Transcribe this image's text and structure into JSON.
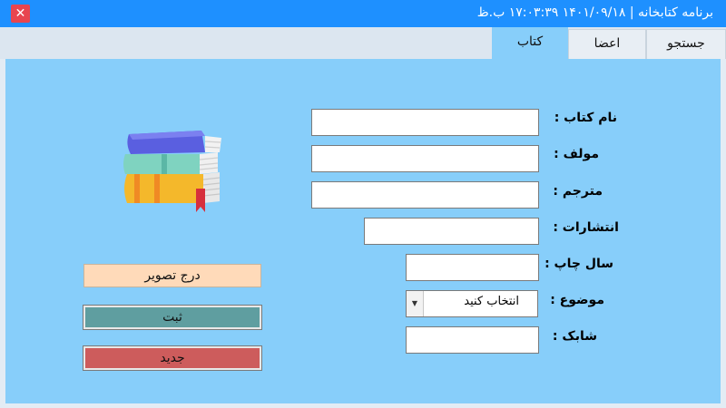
{
  "window": {
    "title": "برنامه کتابخانه  |  ۱۴۰۱/۰۹/۱۸   ۱۷:۰۳:۳۹ ب.ظ",
    "close_glyph": "✕"
  },
  "tabs": [
    {
      "label": "جستجو"
    },
    {
      "label": "اعضا"
    },
    {
      "label": "کتاب",
      "active": true
    }
  ],
  "form": {
    "book_name_label": "نام کتاب :",
    "author_label": "مولف :",
    "translator_label": "مترجم :",
    "publisher_label": "انتشارات :",
    "year_label": "سال چاپ :",
    "subject_label": "موضوع :",
    "isbn_label": "شابک :",
    "book_name_value": "",
    "author_value": "",
    "translator_value": "",
    "publisher_value": "",
    "year_value": "",
    "isbn_value": "",
    "subject_selected": "انتخاب کنید"
  },
  "buttons": {
    "insert_image": "درج تصویر",
    "save": "ثبت",
    "new": "جدید"
  },
  "icons": {
    "books": "books-stack-icon",
    "close": "close-icon",
    "dropdown": "chevron-down-icon"
  }
}
